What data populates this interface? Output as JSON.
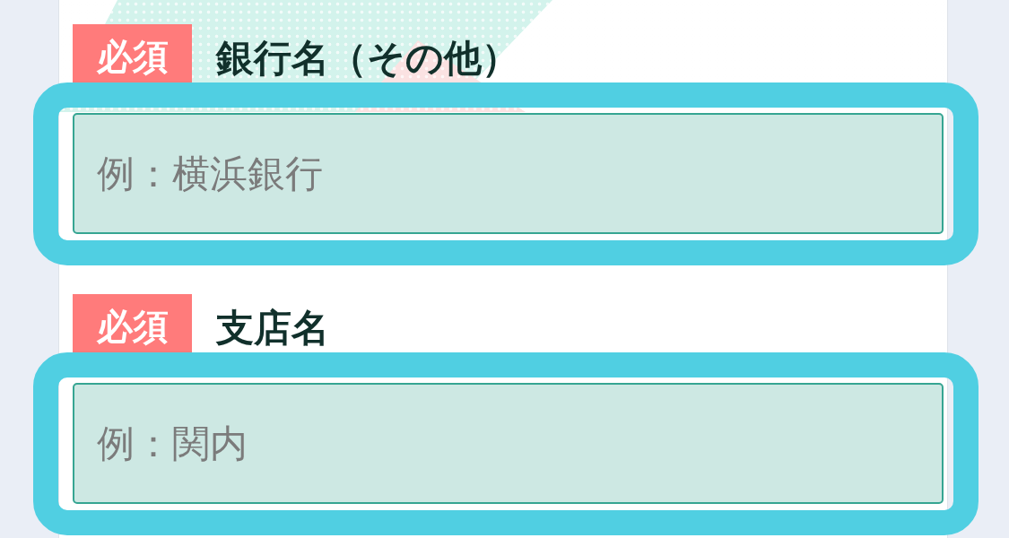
{
  "fields": [
    {
      "badge": "必須",
      "label": "銀行名（その他）",
      "placeholder": "例：横浜銀行",
      "highlighted": true
    },
    {
      "badge": "必須",
      "label": "支店名",
      "placeholder": "例：関内",
      "highlighted": true
    }
  ]
}
